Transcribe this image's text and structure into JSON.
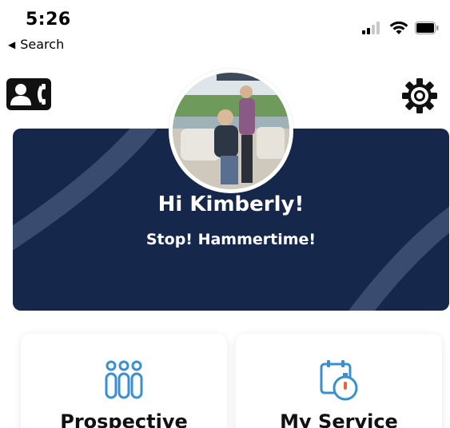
{
  "status": {
    "time": "5:26",
    "back_label": "Search"
  },
  "header": {
    "contact_icon": "contact-card-icon",
    "settings_icon": "gear-icon"
  },
  "banner": {
    "greeting": "Hi Kimberly!",
    "tagline": "Stop! Hammertime!"
  },
  "cards": [
    {
      "label": "Prospective",
      "icon": "people-icon",
      "color": "#3a8fd0"
    },
    {
      "label": "My Service",
      "icon": "calendar-stopwatch-icon",
      "color": "#e8643a"
    }
  ],
  "colors": {
    "banner": "#16274c",
    "icon_blue": "#3a8fd0",
    "accent_orange": "#e8643a"
  }
}
